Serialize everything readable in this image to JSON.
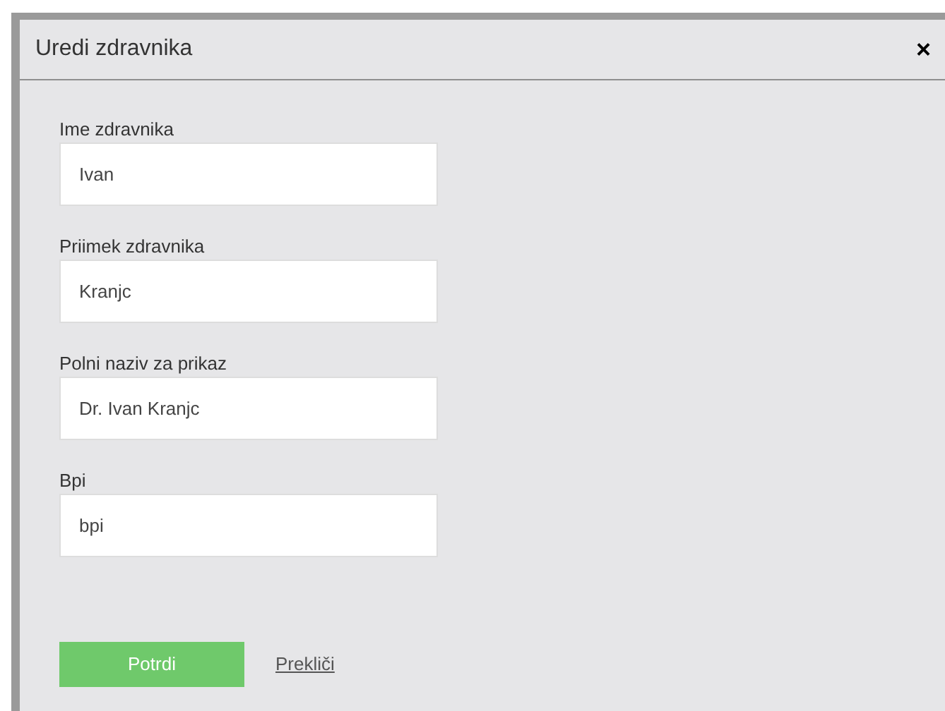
{
  "dialog": {
    "title": "Uredi zdravnika",
    "close": "×"
  },
  "fields": [
    {
      "label": "Ime zdravnika",
      "value": "Ivan"
    },
    {
      "label": "Priimek zdravnika",
      "value": "Kranjc"
    },
    {
      "label": "Polni naziv za prikaz",
      "value": "Dr. Ivan Kranjc"
    },
    {
      "label": "Bpi",
      "value": "bpi"
    }
  ],
  "buttons": {
    "confirm": "Potrdi",
    "cancel": "Prekliči"
  }
}
